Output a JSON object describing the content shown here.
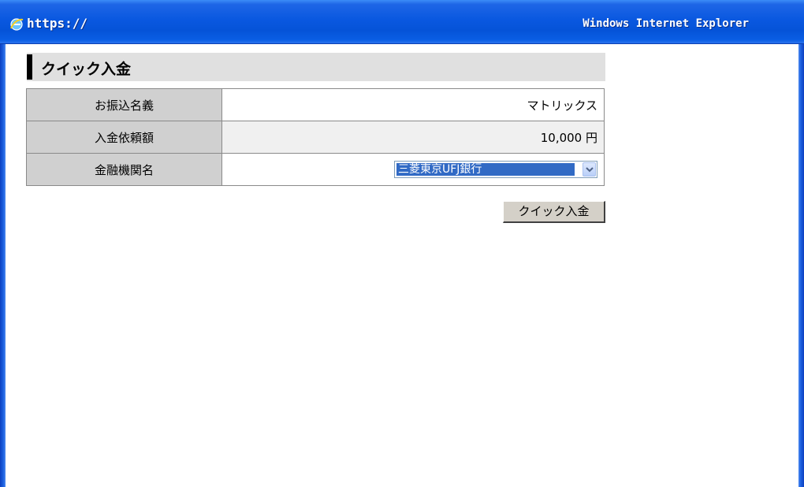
{
  "window": {
    "title_left": "https://",
    "title_right": "Windows Internet Explorer",
    "icon": "internet-explorer-icon"
  },
  "section": {
    "title": "クイック入金"
  },
  "form": {
    "rows": [
      {
        "label": "お振込名義",
        "value": "マトリックス"
      },
      {
        "label": "入金依頼額",
        "value": "10,000 円"
      },
      {
        "label": "金融機関名",
        "selected": "三菱東京UFJ銀行"
      }
    ]
  },
  "button": {
    "label": "クイック入金"
  },
  "colors": {
    "titlebar": "#0553d8",
    "label_bg": "#d0d0d0",
    "header_bg": "#e0e0e0",
    "selection": "#316ac5"
  }
}
